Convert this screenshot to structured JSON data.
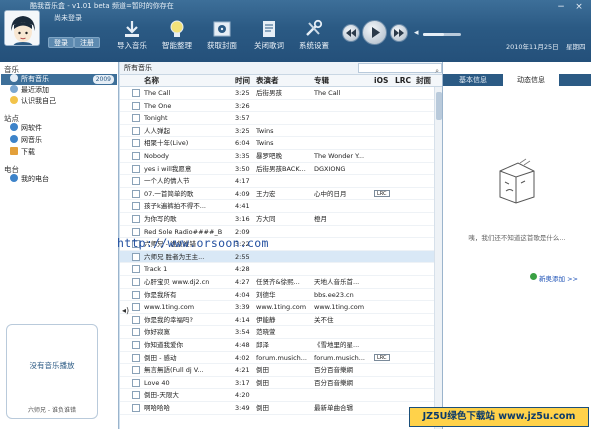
{
  "window": {
    "title": "酷我音乐盒 - v1.01 beta  频道=暂时的你存在"
  },
  "account": {
    "login_hint": "尚未登录",
    "login_label": "登录",
    "register_label": "注册"
  },
  "toolbar": {
    "items": [
      {
        "label": "导入音乐",
        "icon": "import-music-icon"
      },
      {
        "label": "智能整理",
        "icon": "smart-organize-icon"
      },
      {
        "label": "获取封面",
        "icon": "get-cover-icon"
      },
      {
        "label": "关闭歌词",
        "icon": "close-lyrics-icon"
      },
      {
        "label": "系统设置",
        "icon": "settings-icon"
      }
    ]
  },
  "player": {
    "volume": 0.55
  },
  "clock": {
    "date": "2010年11月25日",
    "weekday": "星期四"
  },
  "sidebar": {
    "music_section": "音乐",
    "all_music": "所有音乐",
    "all_music_count": "2009",
    "recent": "最近添加",
    "know_self": "认识我自己",
    "sites_section": "站点",
    "sites": [
      "网软件",
      "网音乐",
      "下载"
    ],
    "radio_section": "电台",
    "my_radio": "我的电台",
    "now_empty": "没有音乐播放",
    "now_playing": "六师兄 - 谁负谁错"
  },
  "list": {
    "breadcrumb": "所有音乐",
    "columns": {
      "name": "名称",
      "time": "时间",
      "artist": "表演者",
      "album": "专辑",
      "ios": "iOS",
      "lrc": "LRC",
      "cover": "封面"
    },
    "rows": [
      {
        "name": "The Call",
        "time": "3:25",
        "artist": "后街男孩",
        "album": "The Call",
        "lrc": ""
      },
      {
        "name": "The One",
        "time": "3:26",
        "artist": "",
        "album": "",
        "lrc": ""
      },
      {
        "name": "Tonight",
        "time": "3:57",
        "artist": "",
        "album": "",
        "lrc": ""
      },
      {
        "name": "人人弹起",
        "time": "3:25",
        "artist": "Twins",
        "album": "",
        "lrc": ""
      },
      {
        "name": "相聚十年(Live)",
        "time": "6:04",
        "artist": "Twins",
        "album": "",
        "lrc": ""
      },
      {
        "name": "Nobody",
        "time": "3:35",
        "artist": "暴罗吧晚",
        "album": "The Wonder Y...",
        "lrc": ""
      },
      {
        "name": "yes i will我愿意",
        "time": "3:50",
        "artist": "后街男孩BACK...",
        "album": "DGXIONG",
        "lrc": ""
      },
      {
        "name": "一个人的情人节",
        "time": "4:17",
        "artist": "",
        "album": "",
        "lrc": ""
      },
      {
        "name": "07.一首简单的歌",
        "time": "4:09",
        "artist": "王力宏",
        "album": "心中的日月",
        "lrc": "LRC"
      },
      {
        "name": "孩子k遍裤拍不得不...",
        "time": "4:41",
        "artist": "",
        "album": "",
        "lrc": ""
      },
      {
        "name": "为你写的歌",
        "time": "3:16",
        "artist": "方大同",
        "album": "橙月",
        "lrc": ""
      },
      {
        "name": "Red Sole Radio####_B",
        "time": "2:09",
        "artist": "",
        "album": "",
        "lrc": ""
      },
      {
        "name": "六师兄 - 谁负谁错",
        "time": "3:22",
        "artist": "",
        "album": "",
        "lrc": ""
      },
      {
        "name": "六师兄 胜者为王主...",
        "time": "2:55",
        "artist": "",
        "album": "",
        "lrc": "",
        "selected": true
      },
      {
        "name": "Track  1",
        "time": "4:28",
        "artist": "",
        "album": "",
        "lrc": ""
      },
      {
        "name": "心肝宝贝 www.dj2.cn",
        "time": "4:27",
        "artist": "任贤齐&徐熙...",
        "album": "天地人音乐首...",
        "lrc": ""
      },
      {
        "name": "你是我所有",
        "time": "4:04",
        "artist": "刘德华",
        "album": "bbs.ee23.cn",
        "lrc": ""
      },
      {
        "name": "www.1ting.com",
        "time": "3:39",
        "artist": "www.1ting.com",
        "album": "www.1ting.com",
        "lrc": ""
      },
      {
        "name": "你是我的幸福吗?",
        "time": "4:14",
        "artist": "伊能静",
        "album": "关不住",
        "lrc": ""
      },
      {
        "name": "你好寂寞",
        "time": "3:54",
        "artist": "范晓萱",
        "album": "",
        "lrc": ""
      },
      {
        "name": "你知道我爱你",
        "time": "4:48",
        "artist": "邱泽",
        "album": "《雪地里的星...",
        "lrc": ""
      },
      {
        "name": "倒田 - 感动",
        "time": "4:02",
        "artist": "forum.musich...",
        "album": "forum.musich...",
        "lrc": "LRC"
      },
      {
        "name": "無言無語(Full dj V...",
        "time": "4:21",
        "artist": "倒田",
        "album": "百分百音樂網",
        "lrc": ""
      },
      {
        "name": "Love 40",
        "time": "3:17",
        "artist": "倒田",
        "album": "百分百音樂網",
        "lrc": ""
      },
      {
        "name": "倒田-天限大",
        "time": "4:20",
        "artist": "",
        "album": "",
        "lrc": ""
      },
      {
        "name": "啊哈哈哈",
        "time": "3:49",
        "artist": "倒田",
        "album": "最新单曲合辑",
        "lrc": ""
      }
    ]
  },
  "right_panel": {
    "tab_basic": "基本信息",
    "tab_dynamic": "动态信息",
    "message": "咦，我们还不知道这首歌是什么...",
    "add_link": "新奥添加 >>"
  },
  "watermark": "http://www.orsoon.com",
  "footer_logo": "JZ5U绿色下载站 www.jz5u.com"
}
